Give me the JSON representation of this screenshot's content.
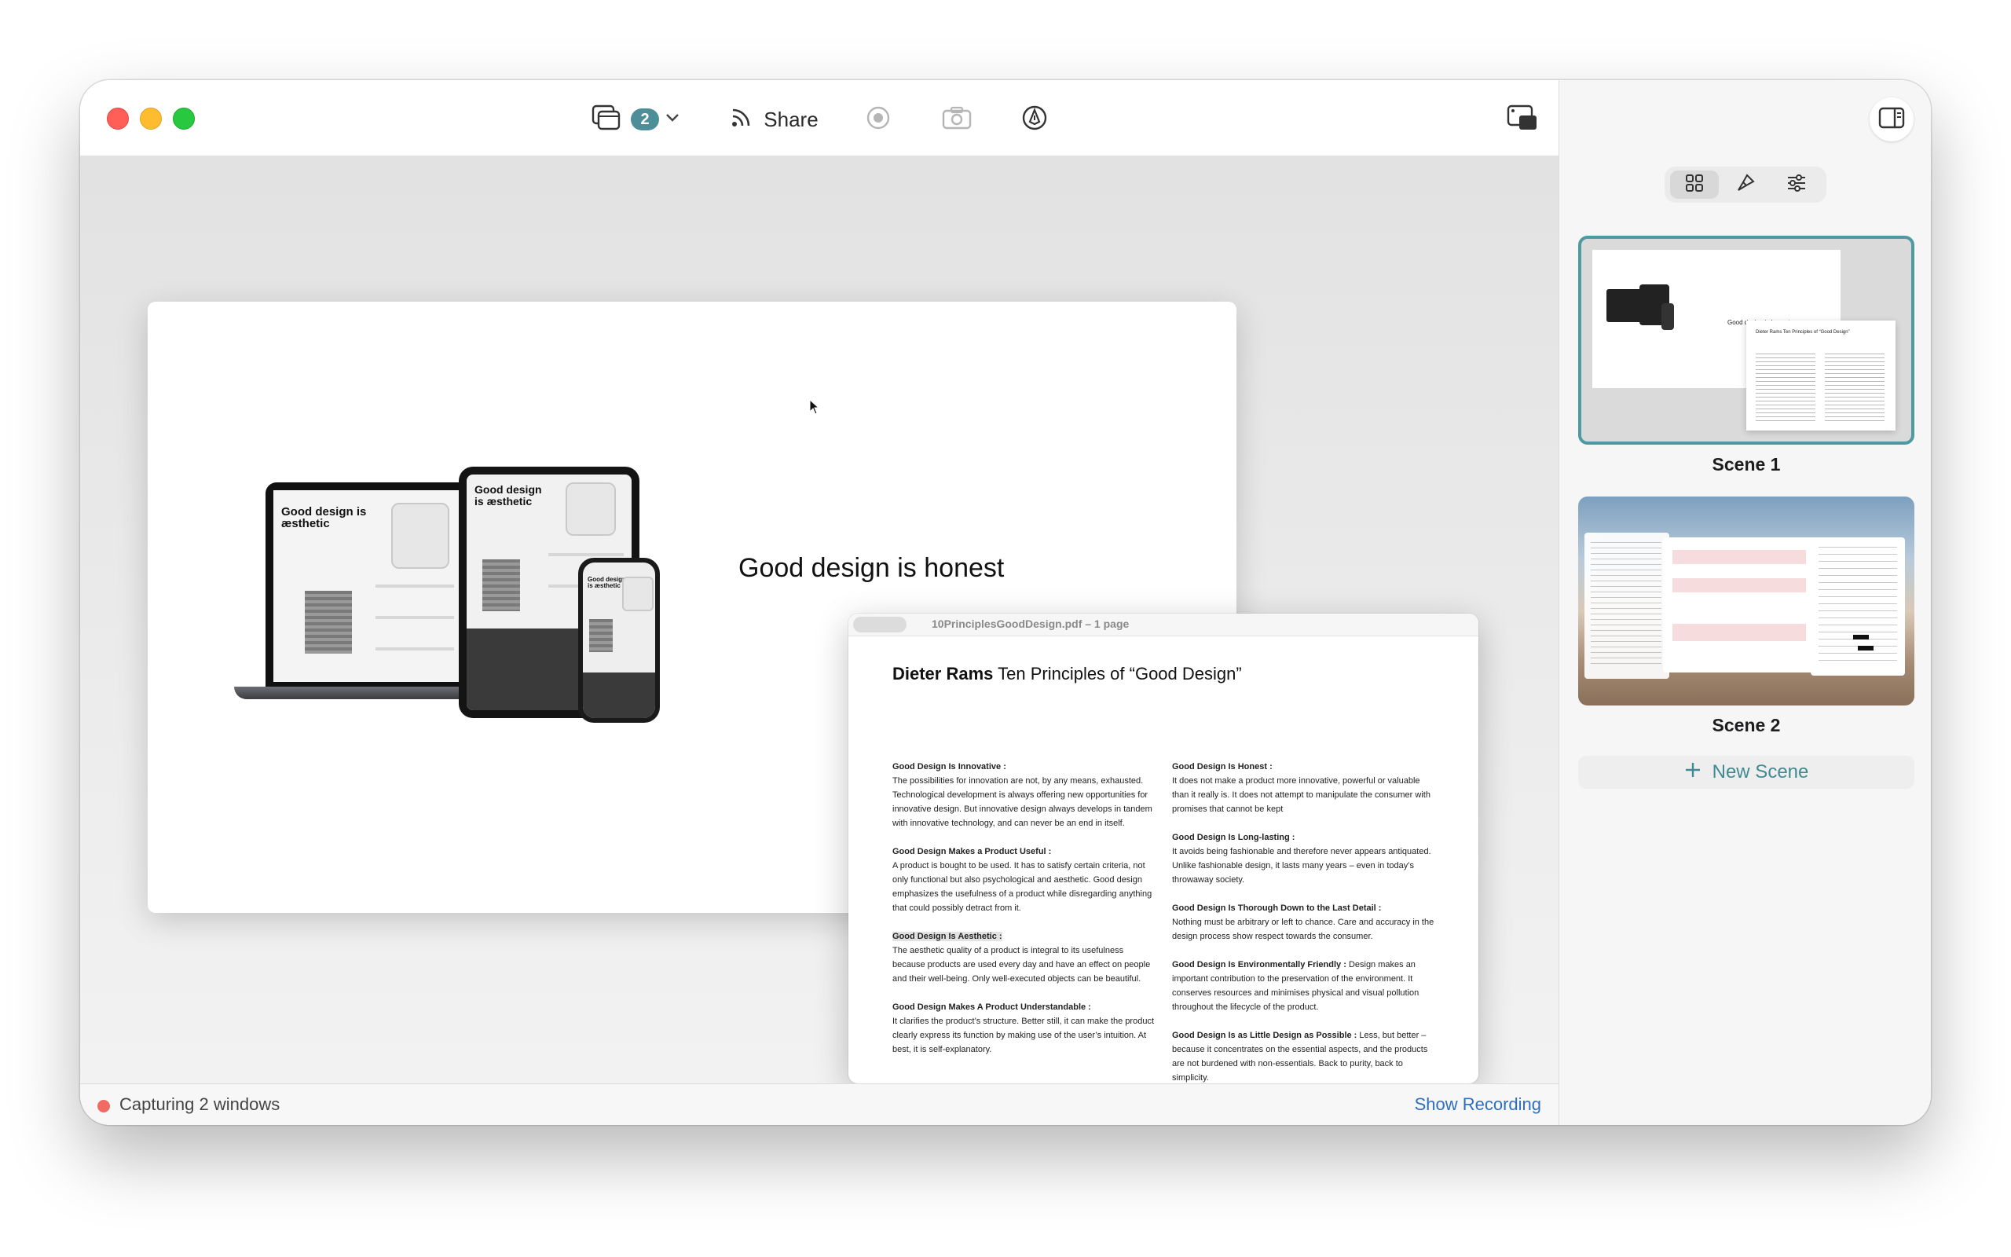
{
  "toolbar": {
    "window_count": "2",
    "share_label": "Share"
  },
  "slide": {
    "title": "Good design is honest",
    "device_caption": "Good design is æsthetic",
    "device_caption_small": "Good design is æsthetic"
  },
  "pdf": {
    "window_title": "10PrinciplesGoodDesign.pdf – 1 page",
    "heading_bold": "Dieter Rams",
    "heading_rest": "Ten Principles of “Good Design”",
    "left_column": [
      {
        "heading": "Good Design Is Innovative :",
        "body": "The possibilities for innovation are not, by any means, exhausted. Technological development is always offering new opportunities for innovative design. But innovative design always develops in tandem with innovative technology, and can never be an end in itself."
      },
      {
        "heading": "Good Design Makes a Product Useful :",
        "body": "A product is bought to be used. It has to satisfy certain criteria, not only functional but also psychological and aesthetic. Good design emphasizes the usefulness of a product while disregarding anything that could possibly detract from it."
      },
      {
        "heading": "Good Design Is Aesthetic :",
        "body": "The aesthetic quality of a product is integral to its usefulness because products are used every day and have an effect on people and their well-being. Only well-executed objects can be beautiful."
      },
      {
        "heading": "Good Design Makes A Product Understandable :",
        "body": "It clarifies the product’s structure. Better still, it can make the product clearly express its function by making use of the user’s intuition. At best, it is self-explanatory."
      }
    ],
    "right_column": [
      {
        "heading": "Good Design Is Honest :",
        "body": "It does not make a product more innovative, powerful or valuable than it really is. It does not attempt to manipulate the consumer with promises that cannot be kept"
      },
      {
        "heading": "Good Design Is Long-lasting :",
        "body": "It avoids being fashionable and therefore never appears antiquated. Unlike fashionable design, it lasts many years – even in today’s throwaway society."
      },
      {
        "heading": "Good Design Is Thorough Down to the Last Detail :",
        "body": "Nothing must be arbitrary or left to chance. Care and accuracy in the design process show respect towards the consumer."
      },
      {
        "heading": "Good Design Is Environmentally Friendly :",
        "body": "Design makes an important contribution to the preservation of the environment. It conserves resources and minimises physical and visual pollution throughout the lifecycle of the product."
      },
      {
        "heading": "Good Design Is as Little Design as Possible :",
        "body": "Less, but better – because it concentrates on the essential aspects, and the products are not burdened with non-essentials. Back to purity, back to simplicity."
      }
    ]
  },
  "status": {
    "text": "Capturing 2 windows",
    "show_recording": "Show Recording"
  },
  "panel": {
    "scenes": [
      {
        "label": "Scene 1",
        "preview_title": "Good design is honest",
        "preview_heading": "Dieter Rams Ten Principles of “Good Design”"
      },
      {
        "label": "Scene 2"
      }
    ],
    "new_scene_label": "New Scene"
  },
  "colors": {
    "accent": "#4d9aa3",
    "badge": "#4d8e98",
    "link": "#2f6fbf",
    "recording": "#ef6b64"
  },
  "icons": [
    "windows-icon",
    "chevron-down-icon",
    "broadcast-icon",
    "record-icon",
    "camera-icon",
    "pen-icon",
    "capture-window-icon",
    "sidebar-toggle-icon",
    "grid-icon",
    "brush-icon",
    "sliders-icon",
    "plus-icon",
    "cursor-icon"
  ]
}
